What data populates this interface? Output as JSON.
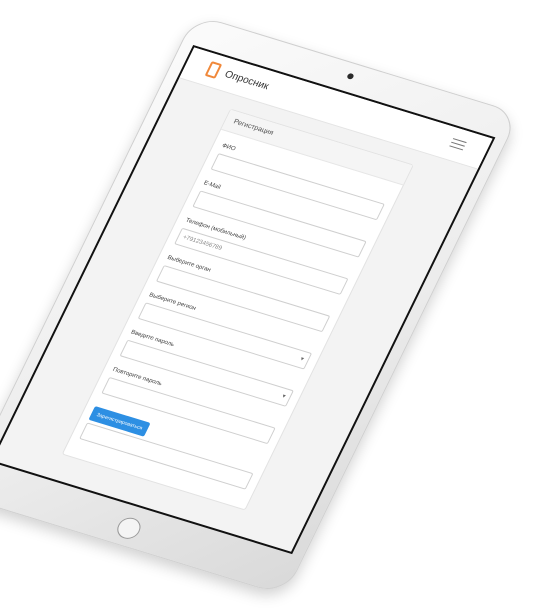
{
  "app": {
    "brand": "Опросник"
  },
  "card": {
    "title": "Регистрация"
  },
  "form": {
    "fio_label": "ФИО",
    "fio_value": "",
    "email_label": "E-Mail",
    "email_value": "",
    "phone_label": "Телефон (мобильный)",
    "phone_placeholder": "+79123456789",
    "organ_label": "Выберите орган",
    "organ_value": "",
    "region_label": "Выберите регион",
    "region_value": "",
    "password_label": "Введите пароль",
    "password_value": "",
    "confirm_label": "Повторите пароль",
    "confirm_value": "",
    "extra_value": "",
    "submit_label": "Зарегистрироваться"
  },
  "icons": {
    "logo": "document-icon",
    "menu": "hamburger-menu-icon",
    "camera": "camera-dot-icon",
    "home": "home-button-icon"
  },
  "colors": {
    "accent": "#2d8fe3",
    "logo": "#f0883a",
    "screen_border": "#111111"
  }
}
